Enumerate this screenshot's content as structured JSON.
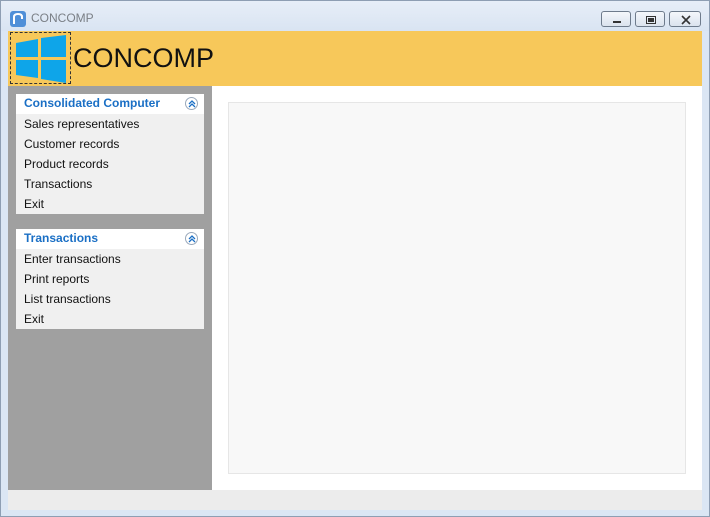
{
  "window": {
    "title": "CONCOMP"
  },
  "header": {
    "brand": "CONCOMP",
    "logo_icon": "windows-logo-icon",
    "background": "#f7c85a",
    "logo_color": "#0ea5e9"
  },
  "sidebar": {
    "panels": [
      {
        "title": "Consolidated Computer",
        "items": [
          "Sales representatives",
          "Customer records",
          "Product records",
          "Transactions",
          "Exit"
        ]
      },
      {
        "title": "Transactions",
        "items": [
          "Enter transactions",
          "Print reports",
          "List transactions",
          "Exit"
        ]
      }
    ]
  },
  "colors": {
    "panel_title": "#1a6fc5",
    "sidebar_bg": "#a0a0a0"
  }
}
